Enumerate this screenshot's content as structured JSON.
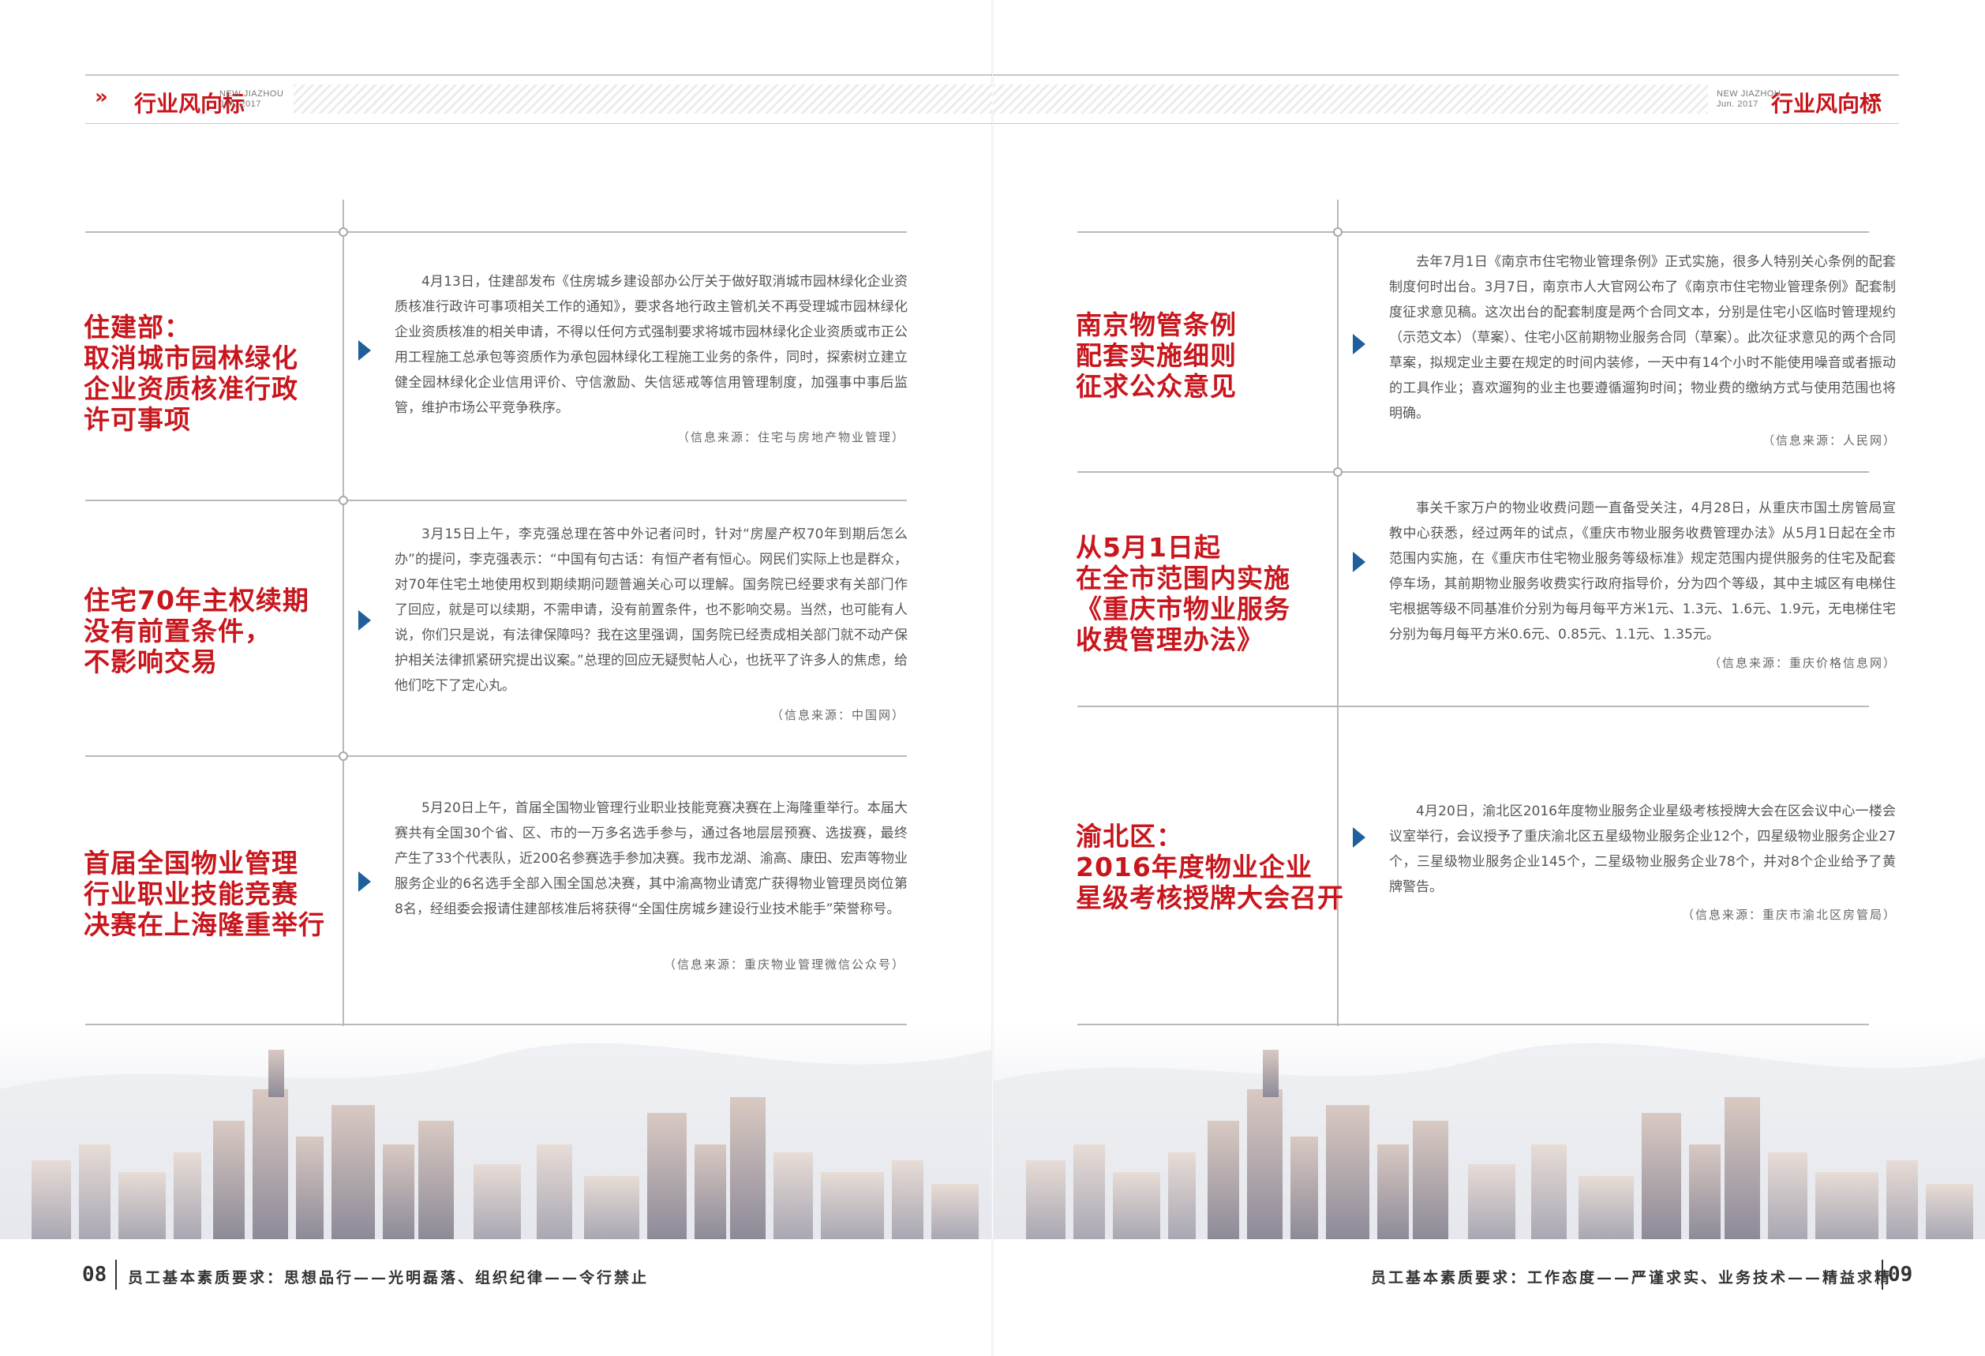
{
  "header": {
    "title": "行业风向标",
    "sub_line1": "NEW JIAZHOU",
    "sub_line2": "Jun. 2017",
    "arrows_left": "»",
    "arrows_right": "«",
    "accent": "#c8161d"
  },
  "left_articles": [
    {
      "headline": [
        "住建部：",
        "取消城市园林绿化",
        "企业资质核准行政",
        "许可事项"
      ],
      "body": "4月13日，住建部发布《住房城乡建设部办公厅关于做好取消城市园林绿化企业资质核准行政许可事项相关工作的通知》，要求各地行政主管机关不再受理城市园林绿化企业资质核准的相关申请，不得以任何方式强制要求将城市园林绿化企业资质或市正公用工程施工总承包等资质作为承包园林绿化工程施工业务的条件，同时，探索树立建立健全园林绿化企业信用评价、守信激励、失信惩戒等信用管理制度，加强事中事后监管，维护市场公平竞争秩序。",
      "source": "（信息来源：住宅与房地产物业管理）"
    },
    {
      "headline": [
        "住宅70年主权续期",
        "没有前置条件，",
        "不影响交易"
      ],
      "body": "3月15日上午，李克强总理在答中外记者问时，针对“房屋产权70年到期后怎么办”的提问，李克强表示：“中国有句古话：有恒产者有恒心。网民们实际上也是群众，对70年住宅土地使用权到期续期问题普遍关心可以理解。国务院已经要求有关部门作了回应，就是可以续期，不需申请，没有前置条件，也不影响交易。当然，也可能有人说，你们只是说，有法律保障吗？我在这里强调，国务院已经责成相关部门就不动产保护相关法律抓紧研究提出议案。”总理的回应无疑熨帖人心，也抚平了许多人的焦虑，给他们吃下了定心丸。",
      "source": "（信息来源：中国网）"
    },
    {
      "headline": [
        "首届全国物业管理",
        "行业职业技能竞赛",
        "决赛在上海隆重举行"
      ],
      "body": "5月20日上午，首届全国物业管理行业职业技能竞赛决赛在上海隆重举行。本届大赛共有全国30个省、区、市的一万多名选手参与，通过各地层层预赛、选拔赛，最终产生了33个代表队，近200名参赛选手参加决赛。我市龙湖、渝高、康田、宏声等物业服务企业的6名选手全部入围全国总决赛，其中渝高物业请宽广获得物业管理员岗位第8名，经组委会报请住建部核准后将获得“全国住房城乡建设行业技术能手”荣誉称号。",
      "source": "（信息来源：重庆物业管理微信公众号）"
    }
  ],
  "right_articles": [
    {
      "headline": [
        "南京物管条例",
        "配套实施细则",
        "征求公众意见"
      ],
      "body": "去年7月1日《南京市住宅物业管理条例》正式实施，很多人特别关心条例的配套制度何时出台。3月7日，南京市人大官网公布了《南京市住宅物业管理条例》配套制度征求意见稿。这次出台的配套制度是两个合同文本，分别是住宅小区临时管理规约（示范文本）（草案）、住宅小区前期物业服务合同（草案）。此次征求意见的两个合同草案，拟规定业主要在规定的时间内装修，一天中有14个小时不能使用噪音或者振动的工具作业；喜欢遛狗的业主也要遵循遛狗时间；物业费的缴纳方式与使用范围也将明确。",
      "source": "（信息来源：人民网）"
    },
    {
      "headline": [
        "从5月1日起",
        "在全市范围内实施",
        "《重庆市物业服务",
        "收费管理办法》"
      ],
      "body": "事关千家万户的物业收费问题一直备受关注，4月28日，从重庆市国土房管局宣教中心获悉，经过两年的试点，《重庆市物业服务收费管理办法》从5月1日起在全市范围内实施，在《重庆市住宅物业服务等级标准》规定范围内提供服务的住宅及配套停车场，其前期物业服务收费实行政府指导价，分为四个等级，其中主城区有电梯住宅根据等级不同基准价分别为每月每平方米1元、1.3元、1.6元、1.9元，无电梯住宅分别为每月每平方米0.6元、0.85元、1.1元、1.35元。",
      "source": "（信息来源：重庆价格信息网）"
    },
    {
      "headline": [
        "渝北区：",
        "2016年度物业企业",
        "星级考核授牌大会召开"
      ],
      "body": "4月20日，渝北区2016年度物业服务企业星级考核授牌大会在区会议中心一楼会议室举行，会议授予了重庆渝北区五星级物业服务企业12个，四星级物业服务企业27个，三星级物业服务企业145个，二星级物业服务企业78个，并对8个企业给予了黄牌警告。",
      "source": "（信息来源：重庆市渝北区房管局）"
    }
  ],
  "footer": {
    "left_page": "08",
    "left_text": "员工基本素质要求：思想品行——光明磊落、组织纪律——令行禁止",
    "right_page": "09",
    "right_text": "员工基本素质要求：工作态度——严谨求实、业务技术——精益求精"
  }
}
